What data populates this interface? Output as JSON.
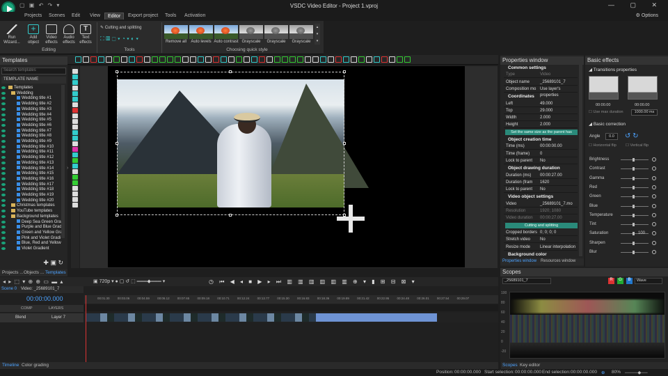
{
  "window": {
    "title": "VSDC Video Editor - Project 1.vproj",
    "controls": "— ▢ ✕"
  },
  "menu": {
    "items": [
      "Projects",
      "Scenes",
      "Edit",
      "View",
      "Editor",
      "Export project",
      "Tools",
      "Activation"
    ],
    "active": "Editor",
    "options": "Options"
  },
  "ribbon": {
    "run": "Run Wizard...",
    "add": "Add object",
    "video_fx": "Video effects",
    "audio_fx": "Audio effects",
    "text_fx": "Text effects",
    "group_editing": "Editing",
    "cutting": "Cutting and splitting",
    "group_tools": "Tools",
    "group_style": "Choosing quick style",
    "styles": [
      "Remove all",
      "Auto levels",
      "Auto contrast",
      "Grayscale",
      "Grayscale",
      "Grayscale"
    ]
  },
  "left": {
    "title": "Templates",
    "search_placeholder": "Search templates",
    "column": "TEMPLATE NAME",
    "tree": [
      "Templates",
      "Wedding",
      "Wedding title #1",
      "Wedding title #2",
      "Wedding title #3",
      "Wedding title #4",
      "Wedding title #5",
      "Wedding title #6",
      "Wedding title #7",
      "Wedding title #8",
      "Wedding title #9",
      "Wedding title #10",
      "Wedding title #11",
      "Wedding title #12",
      "Wedding title #13",
      "Wedding title #14",
      "Wedding title #15",
      "Wedding title #16",
      "Wedding title #17",
      "Wedding title #18",
      "Wedding title #19",
      "Wedding title #20",
      "Christmas templates",
      "YouTube templates",
      "Background templates",
      "Deep Sea Green Grad",
      "Purple and Blue Grad",
      "Green and Yellow Gra",
      "Pink and Violet Gradi",
      "Blue, Red and Yellow",
      "Violet Gradient"
    ],
    "tabs": [
      "Projects ...",
      "Objects ...",
      "Templates"
    ]
  },
  "props": {
    "title": "Properties window",
    "rows": [
      {
        "t": "sec",
        "k": "Common settings"
      },
      {
        "t": "dim",
        "k": "Type",
        "v": "Video"
      },
      {
        "t": "row",
        "k": "Object name",
        "v": "_25689101_7"
      },
      {
        "t": "row",
        "k": "Composition mo",
        "v": "Use layer's properties"
      },
      {
        "t": "sec",
        "k": "Coordinates"
      },
      {
        "t": "row",
        "k": "Left",
        "v": "49.000"
      },
      {
        "t": "row",
        "k": "Top",
        "v": "29.000"
      },
      {
        "t": "row",
        "k": "Width",
        "v": "2.000"
      },
      {
        "t": "row",
        "k": "Height",
        "v": "2.000"
      },
      {
        "t": "btn",
        "k": "Set the same size as the parent has"
      },
      {
        "t": "sec",
        "k": "Object creation time"
      },
      {
        "t": "row",
        "k": "Time (ms)",
        "v": "00:00:00.00"
      },
      {
        "t": "row",
        "k": "Time (frame)",
        "v": "0"
      },
      {
        "t": "row",
        "k": "Lock to parent",
        "v": "No"
      },
      {
        "t": "sec",
        "k": "Object drawing duration"
      },
      {
        "t": "row",
        "k": "Duration (ms)",
        "v": "00:00:27.00"
      },
      {
        "t": "row",
        "k": "Duration (fram",
        "v": "1620"
      },
      {
        "t": "row",
        "k": "Lock to parent",
        "v": "No"
      },
      {
        "t": "sec",
        "k": "Video object settings"
      },
      {
        "t": "row",
        "k": "Video",
        "v": "_25689101_7.mo"
      },
      {
        "t": "dim",
        "k": "Resolution",
        "v": "1920; 1080"
      },
      {
        "t": "dim",
        "k": "Video duration",
        "v": "00:00:27.00"
      },
      {
        "t": "btn",
        "k": "Cutting and splitting"
      },
      {
        "t": "row",
        "k": "Cropped borders",
        "v": "0; 0; 0; 0"
      },
      {
        "t": "row",
        "k": "Stretch video",
        "v": "No"
      },
      {
        "t": "row",
        "k": "Resize mode",
        "v": "Linear interpolation"
      },
      {
        "t": "sec",
        "k": "Background color"
      }
    ],
    "tabs": [
      "Properties window",
      "Resources window"
    ]
  },
  "basic": {
    "title": "Basic effects",
    "transitions": "Transitions properties",
    "t1": "00:00.00",
    "t2": "00:00.00",
    "maxdur_label": "Use max duration",
    "maxdur": "1000.00 ms",
    "correction": "Basic correction",
    "angle_label": "Angle",
    "angle": "0.0",
    "hflip": "Horizontal flip",
    "vflip": "Vertical flip",
    "sliders": [
      {
        "n": "Brightness",
        "v": ""
      },
      {
        "n": "Contrast",
        "v": ""
      },
      {
        "n": "Gamma",
        "v": ""
      },
      {
        "n": "Red",
        "v": ""
      },
      {
        "n": "Green",
        "v": ""
      },
      {
        "n": "Blue",
        "v": ""
      },
      {
        "n": "Temperature",
        "v": ""
      },
      {
        "n": "Tint",
        "v": ""
      },
      {
        "n": "Saturation",
        "v": "100"
      },
      {
        "n": "Sharpen",
        "v": ""
      },
      {
        "n": "Blur",
        "v": ""
      }
    ]
  },
  "timeline": {
    "zoom": "720p",
    "scene": "Scene 0",
    "video_tab": "Video: _25689101_7",
    "time": "00:00:00.000",
    "comp": "COMP",
    "layers": "LAYERS",
    "blend": "Blend",
    "layer": "Layer 7",
    "ticks": [
      "00:01.30",
      "00:03.06",
      "00:04.59",
      "00:06.12",
      "00:07.65",
      "00:09.18",
      "00:10.71",
      "00:12.24",
      "00:13.77",
      "00:15.30",
      "00:16.83",
      "00:18.36",
      "00:19.89",
      "00:21.42",
      "00:22.95",
      "00:24.48",
      "00:26.01",
      "00:27.54",
      "00:29.07"
    ]
  },
  "scopes": {
    "title": "Scopes",
    "source": "_25689101_7",
    "mode": "Wave",
    "r": "R",
    "g": "G",
    "b": "B",
    "labels": [
      "100",
      "80",
      "60",
      "40",
      "20",
      "0",
      "-20"
    ]
  },
  "bottom": {
    "tabs": [
      "Timeline",
      "Color grading"
    ],
    "scopes_tabs": [
      "Scopes",
      "Key editor"
    ]
  },
  "status": {
    "position": "Position:",
    "position_v": "00:00:00.000",
    "start": "Start selection:",
    "start_v": "00:00:00.000",
    "end": "End selection:",
    "end_v": "00:00:00.000",
    "zoom": "80%"
  }
}
